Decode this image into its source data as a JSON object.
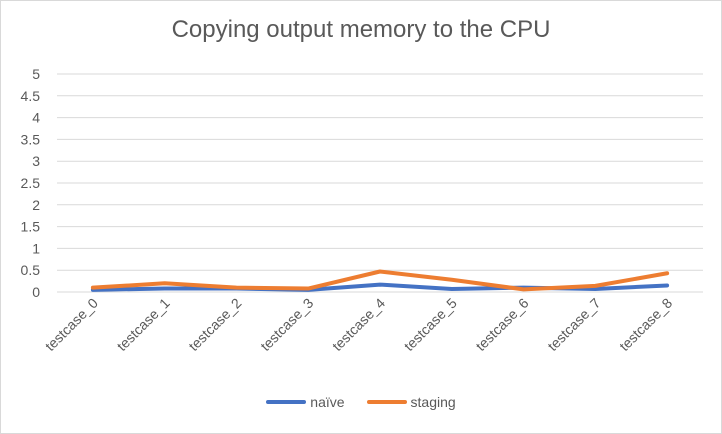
{
  "chart_data": {
    "type": "line",
    "title": "Copying output memory to the CPU",
    "xlabel": "",
    "ylabel": "",
    "categories": [
      "testcase_0",
      "testcase_1",
      "testcase_2",
      "testcase_3",
      "testcase_4",
      "testcase_5",
      "testcase_6",
      "testcase_7",
      "testcase_8"
    ],
    "yticks": [
      "0",
      "0.5",
      "1",
      "1.5",
      "2",
      "2.5",
      "3",
      "3.5",
      "4",
      "4.5",
      "5"
    ],
    "ylim": [
      0,
      5
    ],
    "grid": true,
    "legend_position": "bottom",
    "series": [
      {
        "name": "naïve",
        "color": "#4472C4",
        "values": [
          0.05,
          0.08,
          0.08,
          0.05,
          0.17,
          0.07,
          0.1,
          0.07,
          0.15
        ]
      },
      {
        "name": "staging",
        "color": "#ED7D31",
        "values": [
          0.1,
          0.2,
          0.1,
          0.08,
          0.47,
          0.28,
          0.06,
          0.14,
          0.43
        ]
      }
    ]
  }
}
